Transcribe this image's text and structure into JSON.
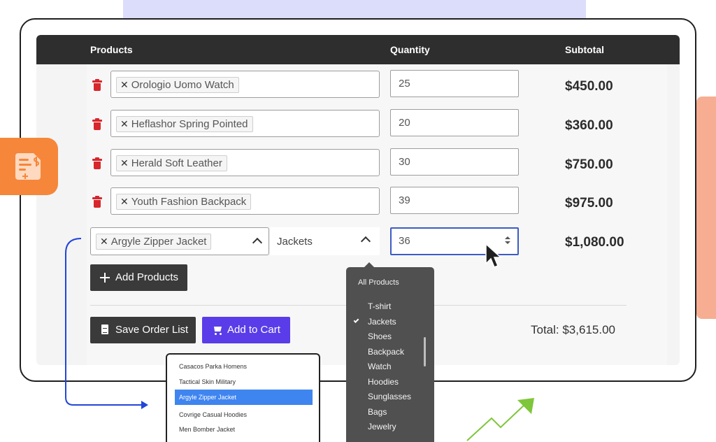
{
  "table": {
    "headers": {
      "products": "Products",
      "quantity": "Quantity",
      "subtotal": "Subtotal"
    },
    "rows": [
      {
        "product": "Orologio Uomo Watch",
        "quantity": "25",
        "subtotal": "$450.00"
      },
      {
        "product": "Heflashor Spring Pointed",
        "quantity": "20",
        "subtotal": "$360.00"
      },
      {
        "product": "Herald Soft Leather",
        "quantity": "30",
        "subtotal": "$750.00"
      },
      {
        "product": "Youth Fashion Backpack",
        "quantity": "39",
        "subtotal": "$975.00"
      }
    ],
    "active_row": {
      "product": "Argyle Zipper Jacket",
      "category": "Jackets",
      "quantity": "36",
      "subtotal": "$1,080.00"
    }
  },
  "actions": {
    "add_products": "Add Products",
    "save_order_list": "Save Order List",
    "add_to_cart": "Add to Cart"
  },
  "total": "Total: $3,615.00",
  "category_dropdown": {
    "header": "All Products",
    "options": [
      "T-shirt",
      "Jackets",
      "Shoes",
      "Backpack",
      "Watch",
      "Hoodies",
      "Sunglasses",
      "Bags",
      "Jewelry"
    ],
    "selected": "Jackets"
  },
  "product_dropdown": {
    "options": [
      "Casacos Parka Homens",
      "Tactical Skin Military",
      "Argyle Zipper Jacket",
      "Covrige Casual Hoodies",
      "Men Bomber Jacket"
    ],
    "selected": "Argyle Zipper Jacket"
  },
  "colors": {
    "header_bg": "#2e2e2e",
    "trash": "#d7262c",
    "primary_button": "#5a3de8",
    "dark_button": "#3a3a3a",
    "selected_option": "#3f85f0",
    "badge": "#f6863a",
    "connector": "#2346d8",
    "growth_arrow": "#7ec63a"
  },
  "icons": {
    "badge": "invoice-dollar-icon",
    "remove": "trash-icon",
    "cursor": "mouse-pointer-icon"
  }
}
